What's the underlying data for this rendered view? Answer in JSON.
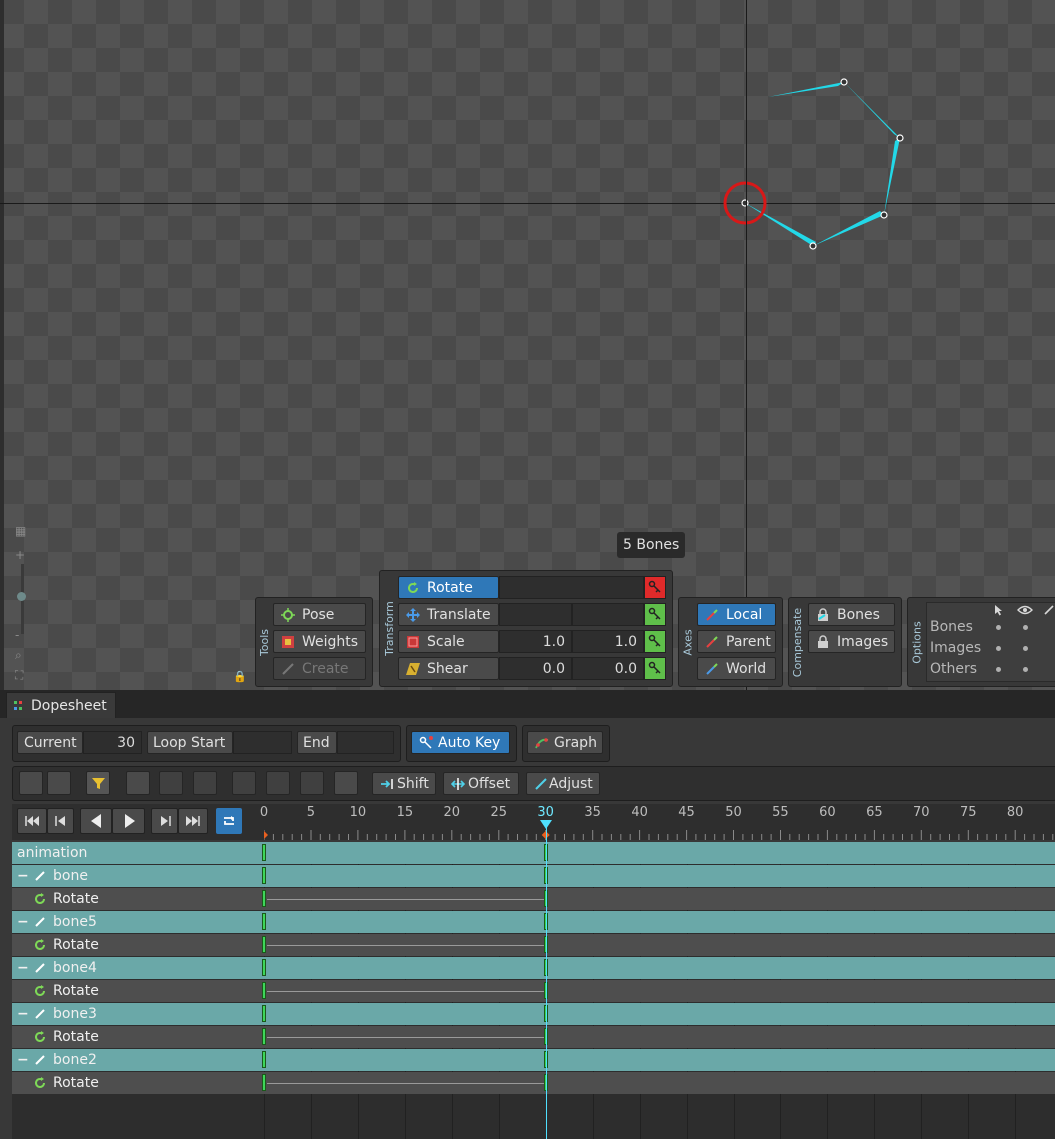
{
  "viewport": {
    "bone_count_tooltip": "5 Bones"
  },
  "tools": {
    "label": "Tools",
    "pose": "Pose",
    "weights": "Weights",
    "create": "Create"
  },
  "transform": {
    "label": "Transform",
    "rotate": "Rotate",
    "translate": "Translate",
    "scale": "Scale",
    "scale_x": "1.0",
    "scale_y": "1.0",
    "shear": "Shear",
    "shear_x": "0.0",
    "shear_y": "0.0"
  },
  "axes": {
    "label": "Axes",
    "local": "Local",
    "parent": "Parent",
    "world": "World"
  },
  "compensate": {
    "label": "Compensate",
    "bones": "Bones",
    "images": "Images"
  },
  "options": {
    "label": "Options",
    "rows": [
      "Bones",
      "Images",
      "Others"
    ]
  },
  "dopesheet": {
    "tab_title": "Dopesheet",
    "current_label": "Current",
    "current_value": "30",
    "loop_start_label": "Loop Start",
    "loop_start_value": "",
    "end_label": "End",
    "end_value": "",
    "auto_key": "Auto Key",
    "graph": "Graph",
    "shift": "Shift",
    "offset": "Offset",
    "adjust": "Adjust",
    "ruler": [
      "0",
      "5",
      "10",
      "15",
      "20",
      "25",
      "30",
      "35",
      "40",
      "45",
      "50",
      "55",
      "60",
      "65",
      "70",
      "75",
      "80"
    ],
    "current_frame": 30,
    "tracks": [
      {
        "type": "anim",
        "label": "animation"
      },
      {
        "type": "bone",
        "label": "bone"
      },
      {
        "type": "rot",
        "label": "Rotate"
      },
      {
        "type": "bone",
        "label": "bone5"
      },
      {
        "type": "rot",
        "label": "Rotate"
      },
      {
        "type": "bone",
        "label": "bone4"
      },
      {
        "type": "rot",
        "label": "Rotate"
      },
      {
        "type": "bone",
        "label": "bone3"
      },
      {
        "type": "rot",
        "label": "Rotate"
      },
      {
        "type": "bone",
        "label": "bone2"
      },
      {
        "type": "rot",
        "label": "Rotate"
      }
    ],
    "keyframes": [
      0,
      30
    ]
  },
  "colors": {
    "accent": "#2f78b8",
    "bone": "#22d8e8",
    "playhead": "#4fe0ff",
    "track": "#6aa8a8",
    "key": "#3ed65a"
  }
}
